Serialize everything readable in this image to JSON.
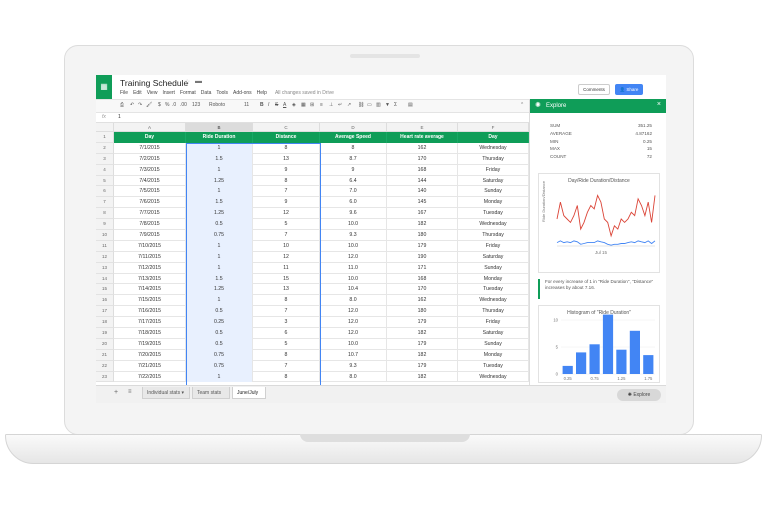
{
  "app": {
    "title": "Training Schedule",
    "menu": [
      "File",
      "Edit",
      "View",
      "Insert",
      "Format",
      "Data",
      "Tools",
      "Add-ons",
      "Help"
    ],
    "save_status": "All changes saved in Drive",
    "comments_label": "Comments",
    "share_label": "Share",
    "font_name": "Roboto",
    "font_size": "11",
    "zoom_text": "123",
    "formula_value": "1"
  },
  "sheet": {
    "columns": [
      "A",
      "B",
      "C",
      "D",
      "E",
      "F"
    ],
    "rows": [
      [
        "Day",
        "Ride Duration",
        "Distance",
        "Average Speed",
        "Heart rate average",
        "Day"
      ],
      [
        "7/1/2015",
        "1",
        "8",
        "8",
        "162",
        "Wednesday"
      ],
      [
        "7/2/2015",
        "1.5",
        "13",
        "8.7",
        "170",
        "Thursday"
      ],
      [
        "7/3/2015",
        "1",
        "9",
        "9",
        "168",
        "Friday"
      ],
      [
        "7/4/2015",
        "1.25",
        "8",
        "6.4",
        "144",
        "Saturday"
      ],
      [
        "7/5/2015",
        "1",
        "7",
        "7.0",
        "140",
        "Sunday"
      ],
      [
        "7/6/2015",
        "1.5",
        "9",
        "6.0",
        "145",
        "Monday"
      ],
      [
        "7/7/2015",
        "1.25",
        "12",
        "9.6",
        "167",
        "Tuesday"
      ],
      [
        "7/8/2015",
        "0.5",
        "5",
        "10.0",
        "182",
        "Wednesday"
      ],
      [
        "7/9/2015",
        "0.75",
        "7",
        "9.3",
        "180",
        "Thursday"
      ],
      [
        "7/10/2015",
        "1",
        "10",
        "10.0",
        "179",
        "Friday"
      ],
      [
        "7/11/2015",
        "1",
        "12",
        "12.0",
        "190",
        "Saturday"
      ],
      [
        "7/12/2015",
        "1",
        "11",
        "11.0",
        "171",
        "Sunday"
      ],
      [
        "7/13/2015",
        "1.5",
        "15",
        "10.0",
        "168",
        "Monday"
      ],
      [
        "7/14/2015",
        "1.25",
        "13",
        "10.4",
        "170",
        "Tuesday"
      ],
      [
        "7/15/2015",
        "1",
        "8",
        "8.0",
        "162",
        "Wednesday"
      ],
      [
        "7/16/2015",
        "0.5",
        "7",
        "12.0",
        "180",
        "Thursday"
      ],
      [
        "7/17/2015",
        "0.25",
        "3",
        "12.0",
        "179",
        "Friday"
      ],
      [
        "7/18/2015",
        "0.5",
        "6",
        "12.0",
        "182",
        "Saturday"
      ],
      [
        "7/19/2015",
        "0.5",
        "5",
        "10.0",
        "179",
        "Sunday"
      ],
      [
        "7/20/2015",
        "0.75",
        "8",
        "10.7",
        "182",
        "Monday"
      ],
      [
        "7/21/2015",
        "0.75",
        "7",
        "9.3",
        "179",
        "Tuesday"
      ],
      [
        "7/22/2015",
        "1",
        "8",
        "8.0",
        "182",
        "Wednesday"
      ]
    ],
    "tabs": [
      "Individual stats",
      "Team stats",
      "June/July"
    ],
    "active_tab": 2
  },
  "explore": {
    "title": "Explore",
    "stats": [
      {
        "label": "SUM",
        "value": "351.25"
      },
      {
        "label": "AVERAGE",
        "value": "4.87162"
      },
      {
        "label": "MIN",
        "value": "0.25"
      },
      {
        "label": "MAX",
        "value": "15"
      },
      {
        "label": "COUNT",
        "value": "72"
      }
    ],
    "line_chart": {
      "title": "Day/Ride Duration/Distance",
      "ylabel": "Ride Duration/Distance",
      "xlabel": "Jul 15"
    },
    "insight": "For every increase of 1 in \"Ride Duration\", \"Distance\" increases by about 7.16.",
    "histogram": {
      "title": "Histogram of \"Ride Duration\""
    },
    "button_label": "Explore"
  },
  "chart_data": [
    {
      "type": "line",
      "title": "Day/Ride Duration/Distance",
      "ylabel": "Ride Duration/Distance",
      "xlabel": "",
      "x_tick_labels": [
        "Jul 15"
      ],
      "series": [
        {
          "values": [
            8,
            13,
            9,
            8,
            7,
            9,
            12,
            5,
            7,
            10,
            12,
            11,
            15,
            13,
            8,
            7,
            3,
            6,
            5,
            8,
            7,
            8,
            10,
            9,
            14,
            12,
            9,
            13,
            7,
            15
          ],
          "color": "#db4437"
        },
        {
          "values": [
            1,
            1.5,
            1,
            1.25,
            1,
            1.5,
            1.25,
            0.5,
            0.75,
            1,
            1,
            1,
            1.5,
            1.25,
            1,
            0.5,
            0.25,
            0.5,
            0.5,
            0.75,
            0.75,
            1,
            1.25,
            1,
            1.5,
            1.25,
            1,
            1.5,
            0.75,
            1.5
          ],
          "color": "#4285f4"
        }
      ]
    },
    {
      "type": "bar",
      "title": "Histogram of \"Ride Duration\"",
      "categories": [
        "0.25",
        "0.5",
        "0.75",
        "1",
        "1.25",
        "1.5",
        "1.75"
      ],
      "x_tick_labels": [
        "0.25",
        "0.75",
        "1.25",
        "1.75"
      ],
      "values": [
        1.5,
        4,
        5.5,
        11,
        4.5,
        8,
        3.5
      ],
      "ylim": [
        0,
        10
      ],
      "y_ticks": [
        0,
        5,
        10
      ],
      "color": "#4285f4"
    }
  ]
}
